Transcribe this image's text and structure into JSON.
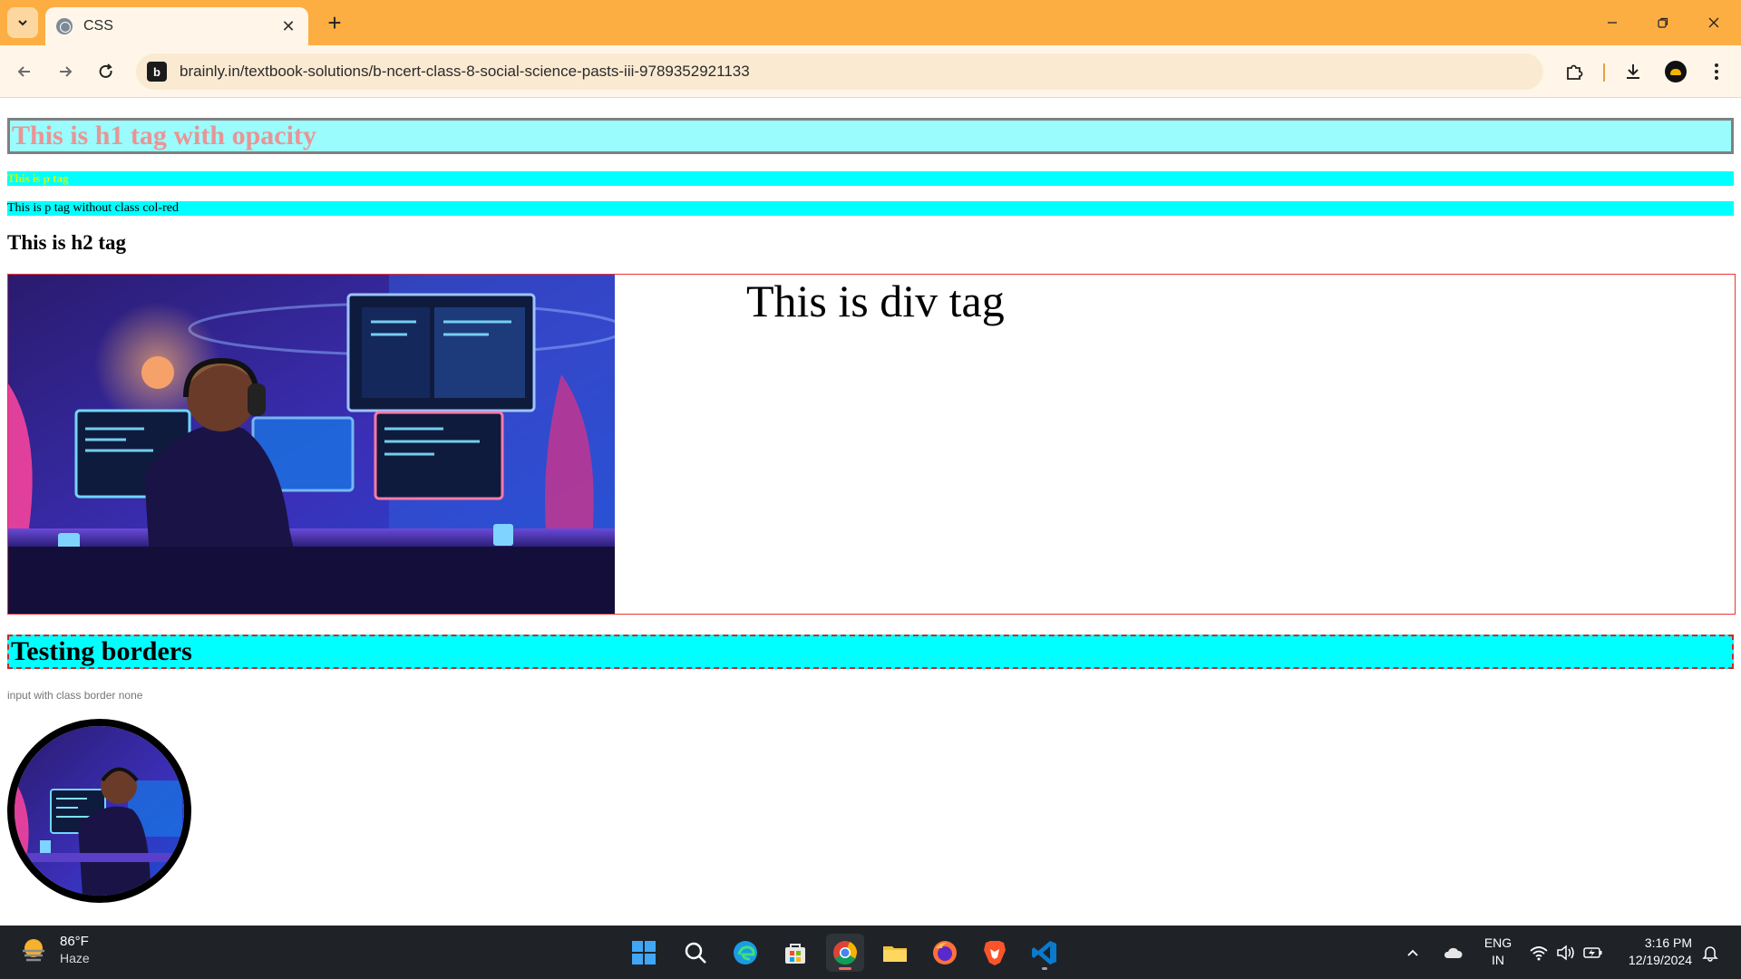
{
  "browser": {
    "tab_title": "CSS",
    "url": "brainly.in/textbook-solutions/b-ncert-class-8-social-science-pasts-iii-9789352921133"
  },
  "page": {
    "h1": "This is h1 tag with opacity",
    "p_colored": "This is p tag",
    "p_plain": "This is p tag without class col-red",
    "h2": "This is h2 tag",
    "div_text": "This is div tag",
    "testing_borders": "Testing borders",
    "input_placeholder": "input with class border none",
    "image_alt": "developer illustration"
  },
  "taskbar": {
    "weather_temp": "86°F",
    "weather_condition": "Haze",
    "language": "ENG",
    "region": "IN",
    "time": "3:16 PM",
    "date": "12/19/2024"
  },
  "colors": {
    "tab_strip": "#fcae42",
    "toolbar": "#fff6e9",
    "cyan_bar": "#00ffff",
    "h1_background": "#9afcfd",
    "h1_text": "#f28a8a",
    "p_colored_text": "#d0ff00",
    "div_border": "#e33333",
    "dashed_border": "#c62b2b",
    "taskbar": "#1f2328"
  }
}
